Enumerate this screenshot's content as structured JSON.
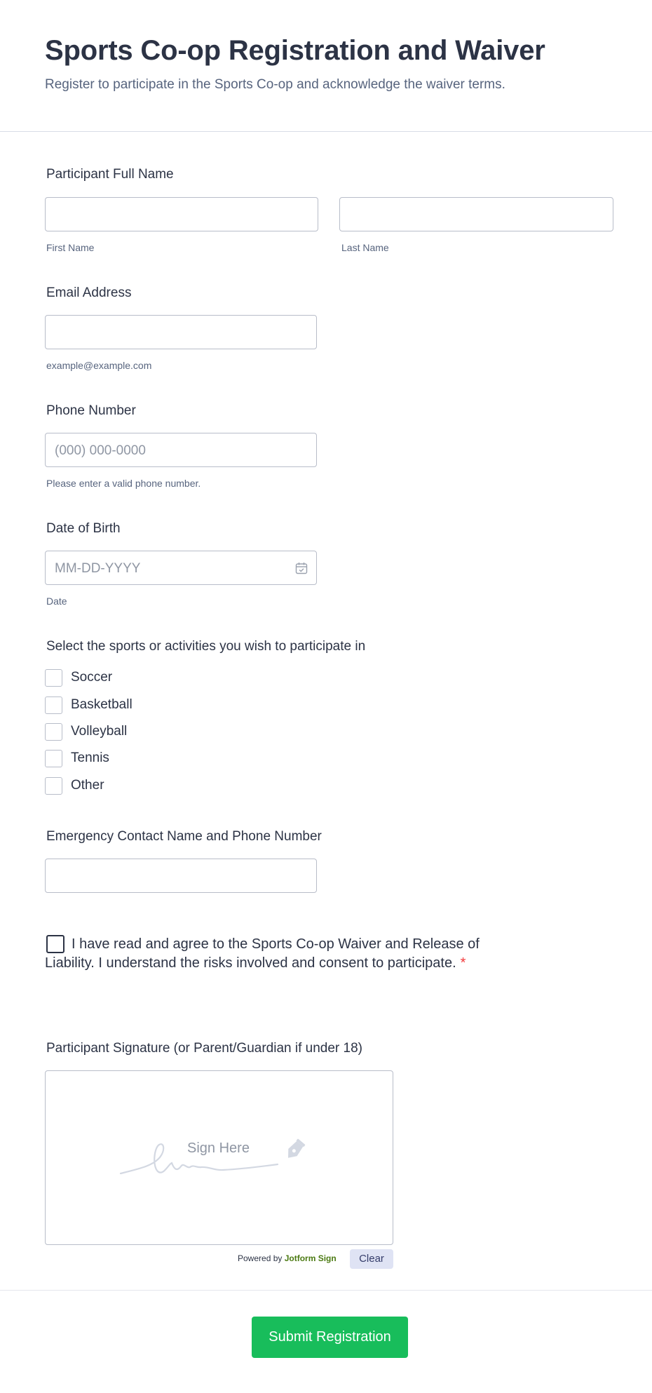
{
  "header": {
    "title": "Sports Co-op Registration and Waiver",
    "subtitle": "Register to participate in the Sports Co-op and acknowledge the waiver terms."
  },
  "fields": {
    "full_name": {
      "label": "Participant Full Name",
      "first_sublabel": "First Name",
      "last_sublabel": "Last Name",
      "first_value": "",
      "last_value": ""
    },
    "email": {
      "label": "Email Address",
      "sublabel": "example@example.com",
      "value": ""
    },
    "phone": {
      "label": "Phone Number",
      "placeholder": "(000) 000-0000",
      "sublabel": "Please enter a valid phone number."
    },
    "dob": {
      "label": "Date of Birth",
      "placeholder": "MM-DD-YYYY",
      "sublabel": "Date",
      "icon": "calendar-icon"
    },
    "sports": {
      "label": "Select the sports or activities you wish to participate in",
      "options": [
        "Soccer",
        "Basketball",
        "Volleyball",
        "Tennis",
        "Other"
      ]
    },
    "emergency": {
      "label": "Emergency Contact Name and Phone Number",
      "value": ""
    },
    "waiver": {
      "text": "I have read and agree to the Sports Co-op Waiver and Release of Liability. I understand the risks involved and consent to participate.",
      "required_mark": "*",
      "checked": false
    },
    "signature": {
      "label": "Participant Signature (or Parent/Guardian if under 18)",
      "placeholder": "Sign Here",
      "powered_by": "Powered by",
      "brand": "Jotform Sign",
      "clear_label": "Clear"
    }
  },
  "submit": {
    "label": "Submit Registration"
  },
  "colors": {
    "submit": "#18bd5b",
    "required": "#f23a3c",
    "brand": "#4b7a12",
    "clear_bg": "#dfe3f4"
  }
}
